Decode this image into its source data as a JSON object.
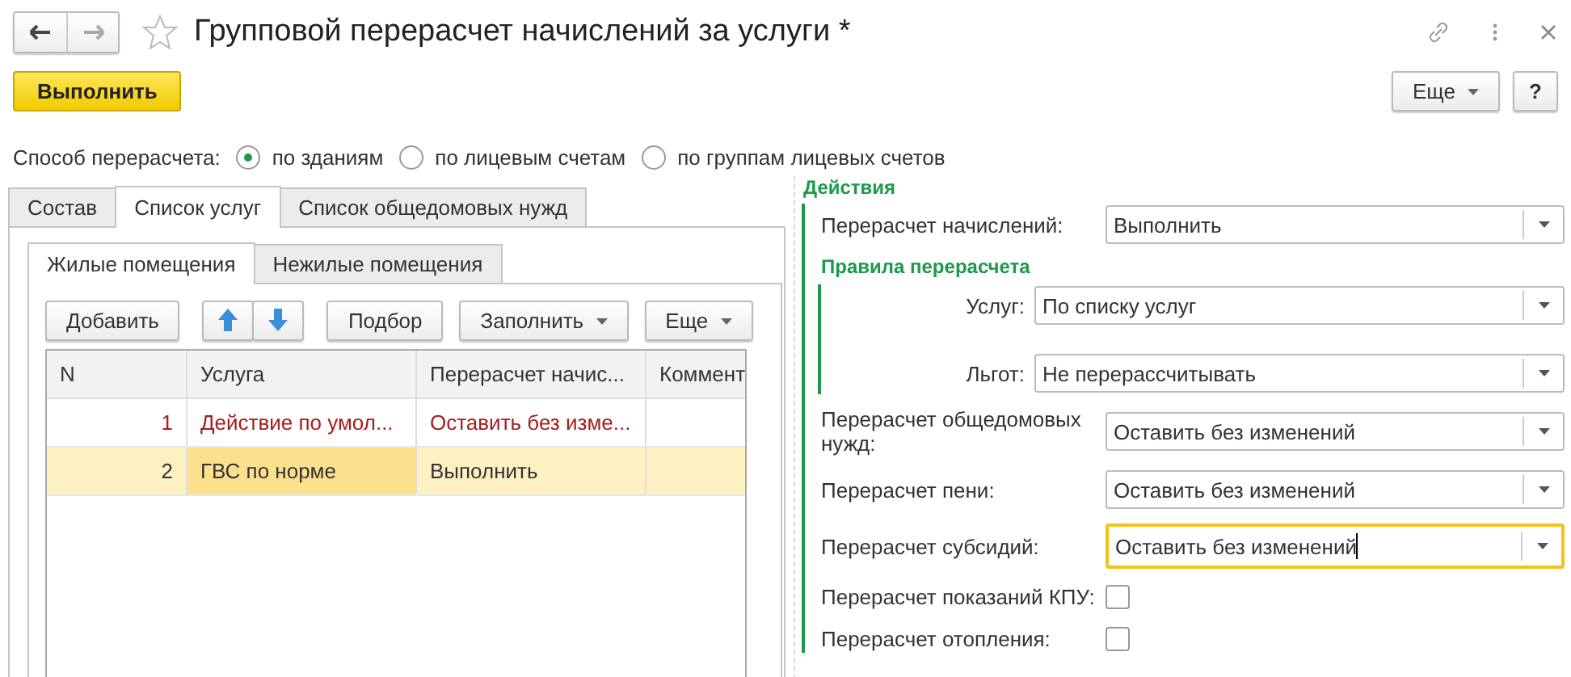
{
  "window": {
    "title": "Групповой перерасчет начислений за услуги *",
    "favorite": false
  },
  "toolbar": {
    "primary": "Выполнить",
    "more": "Еще",
    "help": "?"
  },
  "method": {
    "label": "Способ перерасчета:",
    "options": [
      {
        "label": "по зданиям",
        "selected": true
      },
      {
        "label": "по лицевым счетам",
        "selected": false
      },
      {
        "label": "по группам лицевых счетов",
        "selected": false
      }
    ]
  },
  "tabs": [
    {
      "label": "Состав",
      "selected": false
    },
    {
      "label": "Список услуг",
      "selected": true
    },
    {
      "label": "Список общедомовых нужд",
      "selected": false
    }
  ],
  "subtabs": [
    {
      "label": "Жилые помещения",
      "selected": true
    },
    {
      "label": "Нежилые помещения",
      "selected": false
    }
  ],
  "table_toolbar": {
    "add": "Добавить",
    "pick": "Подбор",
    "fill": "Заполнить",
    "more": "Еще"
  },
  "table": {
    "columns": [
      "N",
      "Услуга",
      "Перерасчет начис...",
      "Коммент"
    ],
    "rows": [
      {
        "n": "1",
        "service": "Действие по умол...",
        "recalc": "Оставить без изме...",
        "warning": true,
        "selected": false,
        "service_current": false
      },
      {
        "n": "2",
        "service": "ГВС по норме",
        "recalc": "Выполнить",
        "warning": false,
        "selected": true,
        "service_current": true
      }
    ]
  },
  "actions": {
    "title": "Действия",
    "items": [
      {
        "kind": "select",
        "label": "Перерасчет начислений:",
        "value": "Выполнить",
        "focused": false
      },
      {
        "kind": "group",
        "title": "Правила перерасчета",
        "children": [
          {
            "kind": "select",
            "label": "Услуг:",
            "value": "По списку услуг",
            "focused": false
          },
          {
            "kind": "select",
            "label": "Льгот:",
            "value": "Не перерассчитывать",
            "focused": false
          }
        ]
      },
      {
        "kind": "select",
        "label": "Перерасчет общедомовых нужд:",
        "value": "Оставить без изменений",
        "focused": false
      },
      {
        "kind": "select",
        "label": "Перерасчет пени:",
        "value": "Оставить без изменений",
        "focused": false
      },
      {
        "kind": "select",
        "label": "Перерасчет субсидий:",
        "value": "Оставить без изменений",
        "focused": true
      },
      {
        "kind": "checkbox",
        "label": "Перерасчет показаний КПУ:",
        "checked": false
      },
      {
        "kind": "checkbox",
        "label": "Перерасчет отопления:",
        "checked": false
      }
    ]
  }
}
